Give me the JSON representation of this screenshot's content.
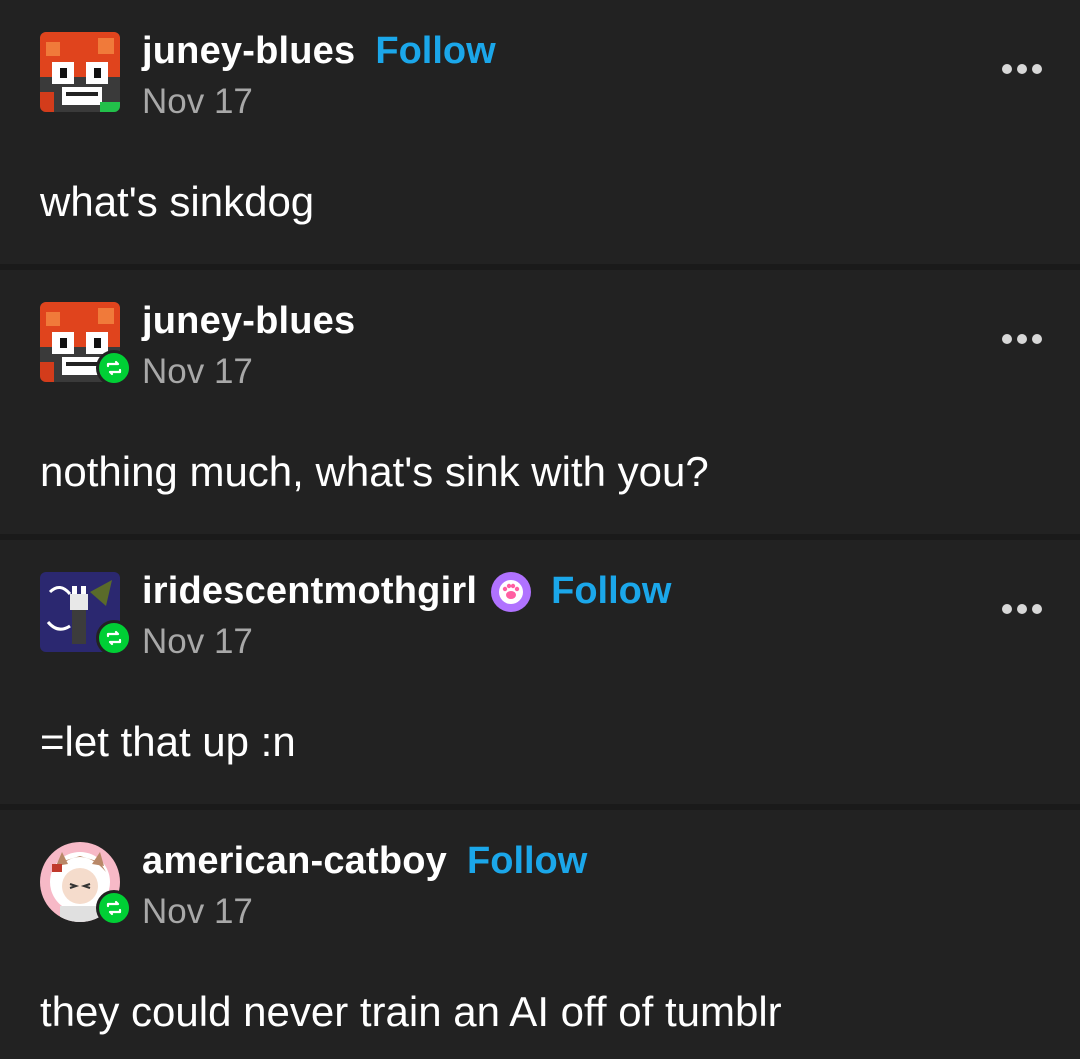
{
  "posts": [
    {
      "username": "juney-blues",
      "follow_label": "Follow",
      "date": "Nov 17",
      "text": "what's sinkdog",
      "reblogged": false,
      "avatar": "juney-avatar"
    },
    {
      "username": "juney-blues",
      "follow_label": "",
      "date": "Nov 17",
      "text": "nothing much, what's sink with you?",
      "reblogged": true,
      "avatar": "juney-avatar"
    },
    {
      "username": "iridescentmothgirl",
      "follow_label": "Follow",
      "date": "Nov 17",
      "text": "=let that up :n",
      "reblogged": true,
      "avatar": "moth-avatar",
      "badge": "paw-badge-icon"
    },
    {
      "username": "american-catboy",
      "follow_label": "Follow",
      "date": "Nov 17",
      "text": "they could never train an AI off of tumblr",
      "reblogged": true,
      "avatar": "catboy-avatar"
    }
  ],
  "colors": {
    "background": "#222222",
    "follow": "#1ba7ea",
    "reblog_badge": "#00cf35",
    "date": "#a8a8a8"
  }
}
